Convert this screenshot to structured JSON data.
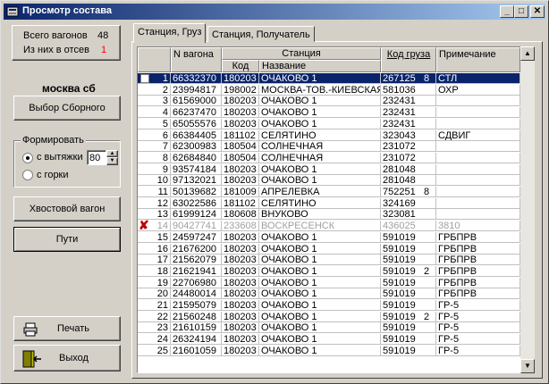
{
  "window": {
    "title": "Просмотр состава"
  },
  "counts": {
    "total_label": "Всего вагонов",
    "total_value": "48",
    "excluded_label": "Из них в отсев",
    "excluded_value": "1"
  },
  "station_name": "москва сб",
  "buttons": {
    "select_group": "Выбор Сборного",
    "tail_wagon": "Хвостовой вагон",
    "paths": "Пути",
    "print": "Печать",
    "exit": "Выход"
  },
  "form_group": {
    "label": "Формировать",
    "opt1": "с вытяжки",
    "opt1_value": "80",
    "opt2": "с горки"
  },
  "tabs": [
    "Станция, Груз",
    "Станция, Получатель"
  ],
  "table": {
    "headers": {
      "wagon": "N вагона",
      "station": "Станция",
      "code": "Код",
      "name": "Название",
      "cargo": "Код груза",
      "note": "Примечание"
    },
    "rows": [
      {
        "n": "1",
        "wagon": "66332370",
        "code": "180203",
        "name": "ОЧАКОВО 1",
        "cargo": "267125",
        "extra": "8",
        "note": "СТЛ"
      },
      {
        "n": "2",
        "wagon": "23994817",
        "code": "198002",
        "name": "МОСКВА-ТОВ.-КИЕВСКАЯ",
        "cargo": "581036",
        "extra": "",
        "note": "ОХР"
      },
      {
        "n": "3",
        "wagon": "61569000",
        "code": "180203",
        "name": "ОЧАКОВО 1",
        "cargo": "232431",
        "extra": "",
        "note": ""
      },
      {
        "n": "4",
        "wagon": "66237470",
        "code": "180203",
        "name": "ОЧАКОВО 1",
        "cargo": "232431",
        "extra": "",
        "note": ""
      },
      {
        "n": "5",
        "wagon": "65055576",
        "code": "180203",
        "name": "ОЧАКОВО 1",
        "cargo": "232431",
        "extra": "",
        "note": ""
      },
      {
        "n": "6",
        "wagon": "66384405",
        "code": "181102",
        "name": "СЕЛЯТИНО",
        "cargo": "323043",
        "extra": "",
        "note": "СДВИГ"
      },
      {
        "n": "7",
        "wagon": "62300983",
        "code": "180504",
        "name": "СОЛНЕЧНАЯ",
        "cargo": "231072",
        "extra": "",
        "note": ""
      },
      {
        "n": "8",
        "wagon": "62684840",
        "code": "180504",
        "name": "СОЛНЕЧНАЯ",
        "cargo": "231072",
        "extra": "",
        "note": ""
      },
      {
        "n": "9",
        "wagon": "93574184",
        "code": "180203",
        "name": "ОЧАКОВО 1",
        "cargo": "281048",
        "extra": "",
        "note": ""
      },
      {
        "n": "10",
        "wagon": "97132021",
        "code": "180203",
        "name": "ОЧАКОВО 1",
        "cargo": "281048",
        "extra": "",
        "note": ""
      },
      {
        "n": "11",
        "wagon": "50139682",
        "code": "181009",
        "name": "АПРЕЛЕВКА",
        "cargo": "752251",
        "extra": "8",
        "note": ""
      },
      {
        "n": "12",
        "wagon": "63022586",
        "code": "181102",
        "name": "СЕЛЯТИНО",
        "cargo": "324169",
        "extra": "",
        "note": ""
      },
      {
        "n": "13",
        "wagon": "61999124",
        "code": "180608",
        "name": "ВНУКОВО",
        "cargo": "323081",
        "extra": "",
        "note": ""
      },
      {
        "n": "14",
        "wagon": "90427741",
        "code": "233608",
        "name": "ВОСКРЕСЕНСК",
        "cargo": "436025",
        "extra": "",
        "note": "3810"
      },
      {
        "n": "15",
        "wagon": "24597247",
        "code": "180203",
        "name": "ОЧАКОВО 1",
        "cargo": "591019",
        "extra": "",
        "note": "ГРБПРВ"
      },
      {
        "n": "16",
        "wagon": "21676200",
        "code": "180203",
        "name": "ОЧАКОВО 1",
        "cargo": "591019",
        "extra": "",
        "note": "ГРБПРВ"
      },
      {
        "n": "17",
        "wagon": "21562079",
        "code": "180203",
        "name": "ОЧАКОВО 1",
        "cargo": "591019",
        "extra": "",
        "note": "ГРБПРВ"
      },
      {
        "n": "18",
        "wagon": "21621941",
        "code": "180203",
        "name": "ОЧАКОВО 1",
        "cargo": "591019",
        "extra": "2",
        "note": "ГРБПРВ"
      },
      {
        "n": "19",
        "wagon": "22706980",
        "code": "180203",
        "name": "ОЧАКОВО 1",
        "cargo": "591019",
        "extra": "",
        "note": "ГРБПРВ"
      },
      {
        "n": "20",
        "wagon": "24480014",
        "code": "180203",
        "name": "ОЧАКОВО 1",
        "cargo": "591019",
        "extra": "",
        "note": "ГРБПРВ"
      },
      {
        "n": "21",
        "wagon": "21595079",
        "code": "180203",
        "name": "ОЧАКОВО 1",
        "cargo": "591019",
        "extra": "",
        "note": "ГР-5"
      },
      {
        "n": "22",
        "wagon": "21560248",
        "code": "180203",
        "name": "ОЧАКОВО 1",
        "cargo": "591019",
        "extra": "2",
        "note": "ГР-5"
      },
      {
        "n": "23",
        "wagon": "21610159",
        "code": "180203",
        "name": "ОЧАКОВО 1",
        "cargo": "591019",
        "extra": "",
        "note": "ГР-5"
      },
      {
        "n": "24",
        "wagon": "26324194",
        "code": "180203",
        "name": "ОЧАКОВО 1",
        "cargo": "591019",
        "extra": "",
        "note": "ГР-5"
      },
      {
        "n": "25",
        "wagon": "21601059",
        "code": "180203",
        "name": "ОЧАКОВО 1",
        "cargo": "591019",
        "extra": "",
        "note": "ГР-5"
      }
    ]
  },
  "colors": {
    "selection": "#0a246a",
    "excluded_marker": "#c00000",
    "count_red": "#ff0000"
  }
}
